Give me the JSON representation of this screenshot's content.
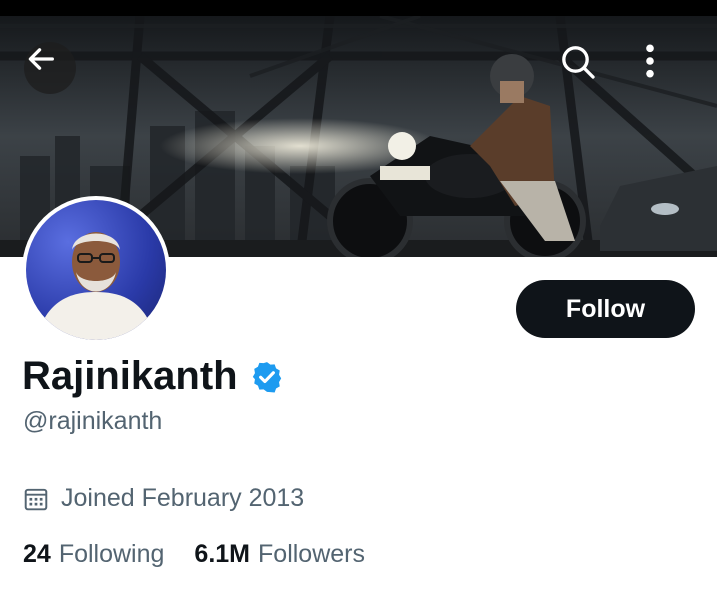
{
  "header": {
    "back_icon": "arrow-left-icon",
    "search_icon": "search-icon",
    "more_icon": "more-vertical-icon"
  },
  "profile": {
    "name": "Rajinikanth",
    "verified": true,
    "handle": "@rajinikanth",
    "follow_label": "Follow",
    "joined": "Joined February 2013",
    "joined_icon": "calendar-icon",
    "following_count": "24",
    "following_label": "Following",
    "followers_count": "6.1M",
    "followers_label": "Followers"
  },
  "colors": {
    "text_primary": "#0f1419",
    "text_secondary": "#536471",
    "verified_blue": "#1d9bf0",
    "button_dark": "#0f1419"
  }
}
